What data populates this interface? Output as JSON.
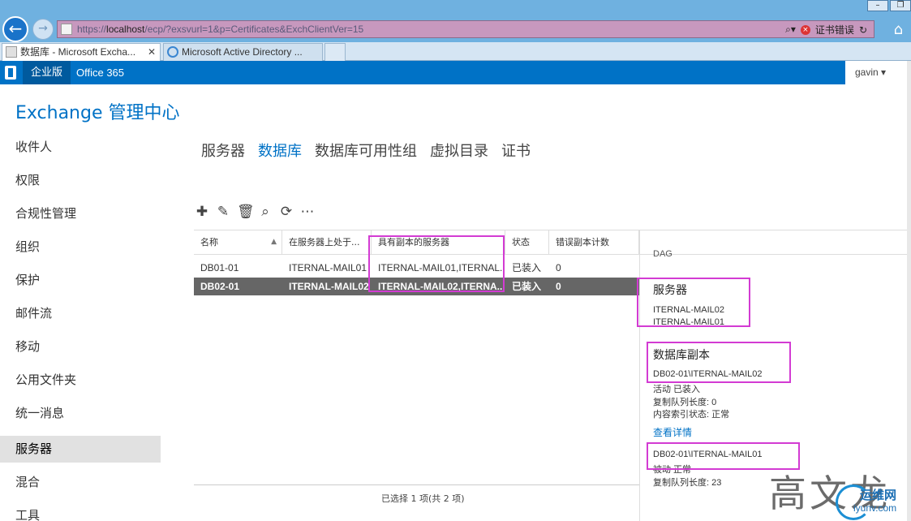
{
  "browser": {
    "url_prefix": "https://",
    "url_host": "localhost",
    "url_rest": "/ecp/?exsvurl=1&p=Certificates&ExchClientVer=15",
    "cert_error_label": "证书错误",
    "tabs": [
      {
        "title": "数据库 - Microsoft Excha...",
        "active": true
      },
      {
        "title": "Microsoft Active Directory ...",
        "active": false
      }
    ]
  },
  "o365": {
    "edition": "企业版",
    "office_link": "Office 365",
    "user": "gavin"
  },
  "app_title": "Exchange 管理中心",
  "leftnav": [
    {
      "label": "收件人"
    },
    {
      "label": "权限"
    },
    {
      "label": "合规性管理"
    },
    {
      "label": "组织"
    },
    {
      "label": "保护"
    },
    {
      "label": "邮件流"
    },
    {
      "label": "移动"
    },
    {
      "label": "公用文件夹"
    },
    {
      "label": "统一消息"
    },
    {
      "label": "服务器",
      "selected": true
    },
    {
      "label": "混合"
    },
    {
      "label": "工具"
    }
  ],
  "subtabs": [
    {
      "label": "服务器"
    },
    {
      "label": "数据库",
      "active": true
    },
    {
      "label": "数据库可用性组"
    },
    {
      "label": "虚拟目录"
    },
    {
      "label": "证书"
    }
  ],
  "toolbar": {
    "icons": [
      "add-icon",
      "edit-icon",
      "delete-icon",
      "search-icon",
      "refresh-icon",
      "more-icon"
    ]
  },
  "grid": {
    "columns": [
      "名称",
      "在服务器上处于...",
      "具有副本的服务器",
      "状态",
      "错误副本计数"
    ],
    "rows": [
      {
        "name": "DB01-01",
        "server": "ITERNAL-MAIL01",
        "copies": "ITERNAL-MAIL01,ITERNAL...",
        "status": "已装入",
        "bad_copy": "0",
        "selected": false
      },
      {
        "name": "DB02-01",
        "server": "ITERNAL-MAIL02",
        "copies": "ITERNAL-MAIL02,ITERNA...",
        "status": "已装入",
        "bad_copy": "0",
        "selected": true
      }
    ],
    "status_text": "已选择 1 项(共 2 项)"
  },
  "detail": {
    "dag_label": "DAG",
    "servers_heading": "服务器",
    "servers": [
      "ITERNAL-MAIL02",
      "ITERNAL-MAIL01"
    ],
    "copies_heading": "数据库副本",
    "copy1": {
      "name": "DB02-01\\ITERNAL-MAIL02",
      "state": "活动 已装入",
      "queue": "复制队列长度: 0",
      "index": "内容索引状态: 正常",
      "link": "查看详情"
    },
    "copy2": {
      "name": "DB02-01\\ITERNAL-MAIL01",
      "state": "被动 正常",
      "queue": "复制队列长度: 23"
    }
  },
  "watermark": {
    "text": "高文龙",
    "site_cn": "运维网",
    "site_en": "iyunv.com"
  },
  "colors": {
    "brand_blue": "#0072c6",
    "highlight": "#d33bd3",
    "selected_row": "#666666"
  }
}
